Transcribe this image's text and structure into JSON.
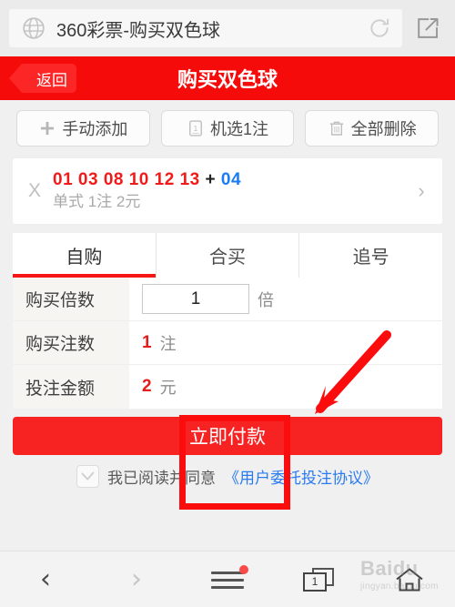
{
  "browser": {
    "globe_icon": "globe-icon",
    "url_title": "360彩票-购买双色球",
    "refresh_icon": "refresh-icon",
    "share_icon": "share-icon"
  },
  "header": {
    "back_label": "返回",
    "title": "购买双色球",
    "bg_color": "#f60b0b"
  },
  "actions": [
    {
      "label": "手动添加",
      "icon": "plus-icon"
    },
    {
      "label": "机选1注",
      "icon": "ticket-one-icon"
    },
    {
      "label": "全部删除",
      "icon": "trash-icon"
    }
  ],
  "ticket": {
    "delete_label": "X",
    "red_numbers": "01 03 08 10 12 13",
    "separator": "+",
    "blue_number": "04",
    "subtitle": "单式  1注  2元",
    "chevron": "›",
    "red_color": "#ef1b1b",
    "blue_color": "#1a7cf2"
  },
  "tabs": [
    {
      "label": "自购",
      "active": true
    },
    {
      "label": "合买",
      "active": false
    },
    {
      "label": "追号",
      "active": false
    }
  ],
  "form": {
    "multiplier": {
      "label": "购买倍数",
      "value": "1",
      "unit": "倍"
    },
    "bets": {
      "label": "购买注数",
      "value": "1",
      "unit": "注"
    },
    "amount": {
      "label": "投注金额",
      "value": "2",
      "unit": "元"
    }
  },
  "pay": {
    "button_label": "立即付款",
    "button_color": "#f72323",
    "agree_text": "我已阅读并同意",
    "agree_link": "《用户委托投注协议》",
    "checkbox_checked": false
  },
  "bottom_nav": {
    "back_icon": "chevron-left-icon",
    "forward_icon": "chevron-right-icon",
    "menu_icon": "hamburger-menu-icon",
    "tabs_icon": "tabs-icon",
    "tab_count": "1",
    "home_icon": "home-icon"
  },
  "annotation": {
    "arrow_color": "#fc0d0d",
    "rect_color": "#fc0d0d"
  },
  "watermark": {
    "main": "Baidu",
    "sub": "jingyan.baidu.com"
  }
}
